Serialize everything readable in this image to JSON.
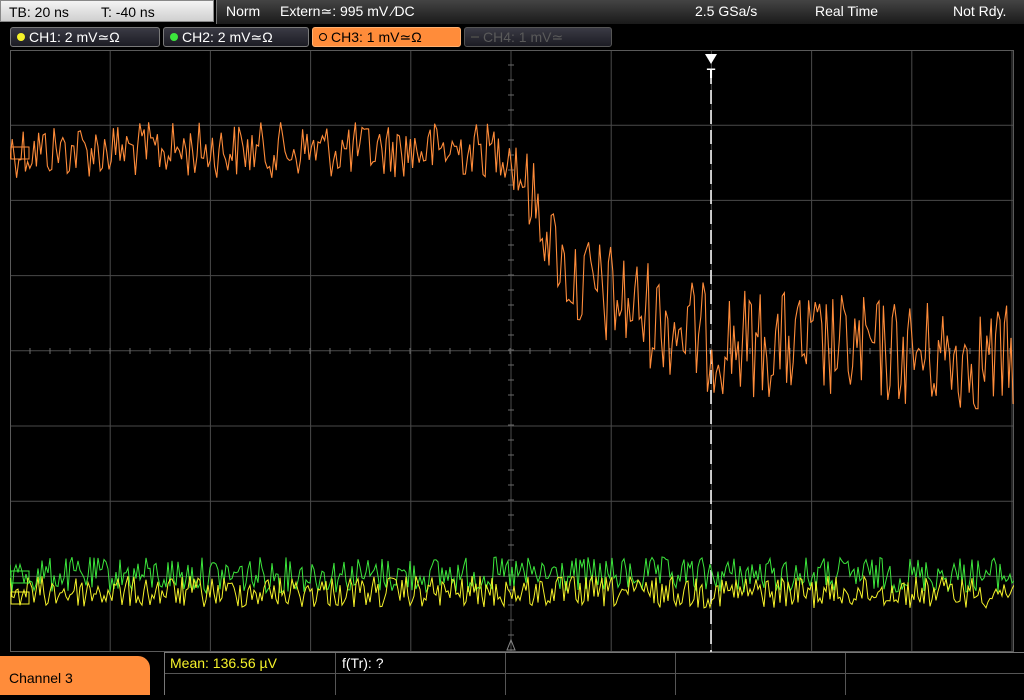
{
  "timebase": {
    "tb_label": "TB: 20 ns",
    "t_label": "T: -40 ns"
  },
  "status": {
    "mode": "Norm",
    "trigger": "Extern≃: 995 mV ∕DC",
    "sample_rate": "2.5 GSa/s",
    "acq_mode": "Real Time",
    "ready_state": "Not Rdy."
  },
  "channels": [
    {
      "label": "CH1: 2 mV≃Ω",
      "color": "#f5f22a",
      "state": "on"
    },
    {
      "label": "CH2: 2 mV≃Ω",
      "color": "#3ce63c",
      "state": "on"
    },
    {
      "label": "CH3: 1 mV≃Ω",
      "color": "#ff8c3a",
      "state": "active"
    },
    {
      "label": "CH4: 1 mV≃",
      "color": "#555555",
      "state": "off"
    }
  ],
  "trigger_marker": "T",
  "bottom": {
    "channel_tab": "Channel 3",
    "mean_label": "Mean: 136.56 µV",
    "ftr_label": "f(Tr): ?"
  },
  "colors": {
    "ch1": "#f5f22a",
    "ch2": "#3ce63c",
    "ch3": "#ff8c3a",
    "grid": "#4a4a4a"
  }
}
